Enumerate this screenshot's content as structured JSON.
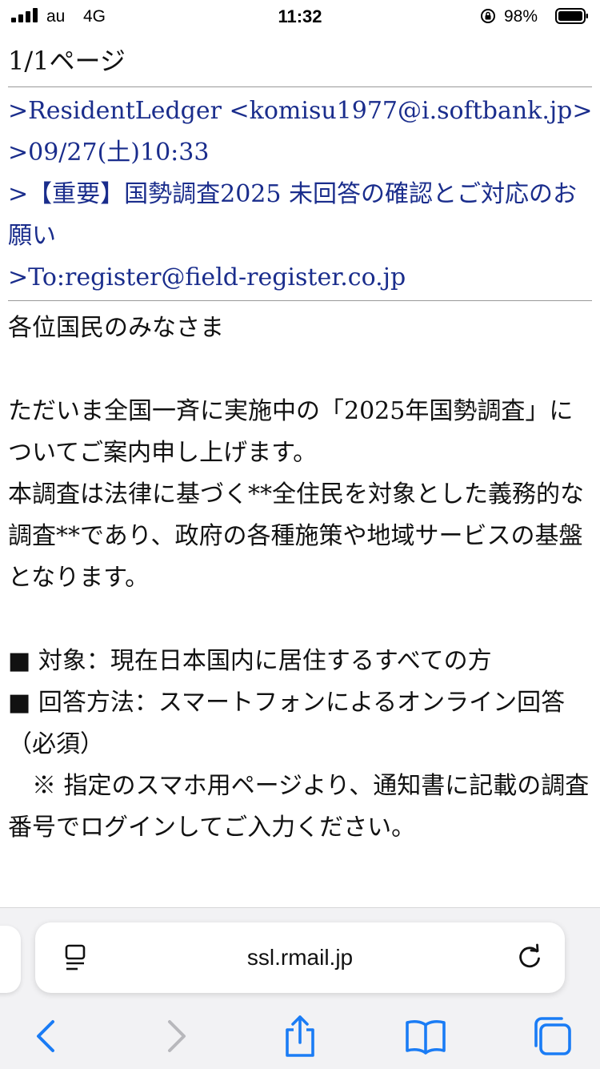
{
  "status_bar": {
    "carrier": "au",
    "network": "4G",
    "time": "11:32",
    "battery": "98%"
  },
  "mail": {
    "page_indicator": "1/1ページ",
    "from": ">ResidentLedger <komisu1977@i.softbank.jp>",
    "date": ">09/27(土)10:33",
    "subject": ">【重要】国勢調査2025 未回答の確認とご対応のお願い",
    "to": ">To:register@field-register.co.jp",
    "body": {
      "greeting": "各位国民のみなさま",
      "para1": "ただいま全国一斉に実施中の「2025年国勢調査」についてご案内申し上げます。",
      "para2": "本調査は法律に基づく**全住民を対象とした義務的な調査**であり、政府の各種施策や地域サービスの基盤となります。",
      "bullet1": "■ 対象：現在日本国内に居住するすべての方",
      "bullet2": "■ 回答方法：スマートフォンによるオンライン回答（必須）",
      "note": "　※ 指定のスマホ用ページより、通知書に記載の調査番号でログインしてご入力ください。"
    }
  },
  "browser": {
    "url": "ssl.rmail.jp",
    "accent_color": "#1a7cf5",
    "disabled_color": "#b8b8bc"
  }
}
